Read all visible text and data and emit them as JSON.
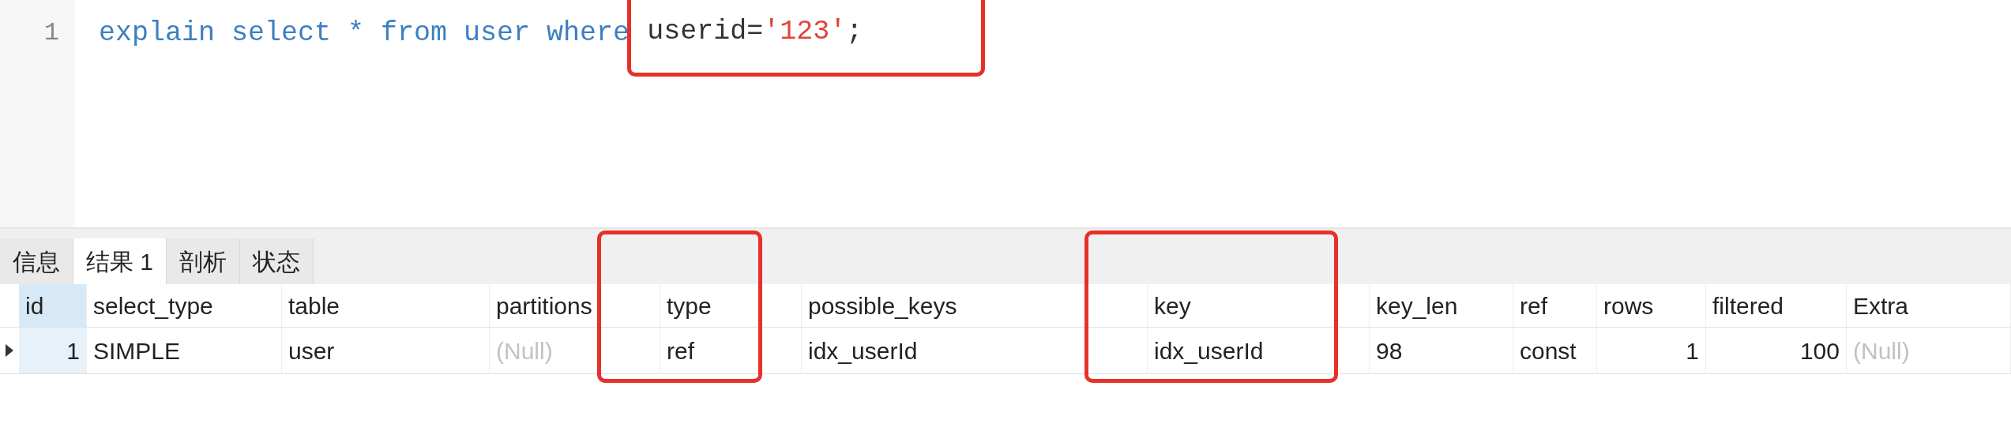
{
  "editor": {
    "lines": [
      {
        "number": "1",
        "segments": [
          {
            "text": "explain select * from user where ",
            "kind": "keyword",
            "highlighted": false
          },
          {
            "text": "userid=",
            "kind": "plain",
            "highlighted": true
          },
          {
            "text": "'123'",
            "kind": "string",
            "highlighted": true
          },
          {
            "text": ";",
            "kind": "plain",
            "highlighted": true
          }
        ]
      }
    ]
  },
  "tabs": [
    {
      "label": "信息",
      "selected": false
    },
    {
      "label": "结果 1",
      "selected": true
    },
    {
      "label": "剖析",
      "selected": false
    },
    {
      "label": "状态",
      "selected": false
    }
  ],
  "table": {
    "columns": [
      {
        "label": "id",
        "kind": "number",
        "selected": true,
        "highlighted": false
      },
      {
        "label": "select_type",
        "kind": "text",
        "selected": false,
        "highlighted": false
      },
      {
        "label": "table",
        "kind": "text",
        "selected": false,
        "highlighted": false
      },
      {
        "label": "partitions",
        "kind": "text",
        "selected": false,
        "highlighted": false
      },
      {
        "label": "type",
        "kind": "text",
        "selected": false,
        "highlighted": true
      },
      {
        "label": "possible_keys",
        "kind": "text",
        "selected": false,
        "highlighted": false
      },
      {
        "label": "key",
        "kind": "text",
        "selected": false,
        "highlighted": true
      },
      {
        "label": "key_len",
        "kind": "text",
        "selected": false,
        "highlighted": false
      },
      {
        "label": "ref",
        "kind": "text",
        "selected": false,
        "highlighted": false
      },
      {
        "label": "rows",
        "kind": "number",
        "selected": false,
        "highlighted": false
      },
      {
        "label": "filtered",
        "kind": "number",
        "selected": false,
        "highlighted": false
      },
      {
        "label": "Extra",
        "kind": "text",
        "selected": false,
        "highlighted": false
      }
    ],
    "rows": [
      {
        "selected": true,
        "cells": [
          {
            "text": "1",
            "null": false
          },
          {
            "text": "SIMPLE",
            "null": false
          },
          {
            "text": "user",
            "null": false
          },
          {
            "text": "(Null)",
            "null": true
          },
          {
            "text": "ref",
            "null": false
          },
          {
            "text": "idx_userId",
            "null": false
          },
          {
            "text": "idx_userId",
            "null": false
          },
          {
            "text": "98",
            "null": false
          },
          {
            "text": "const",
            "null": false
          },
          {
            "text": "1",
            "null": false
          },
          {
            "text": "100",
            "null": false
          },
          {
            "text": "(Null)",
            "null": true
          }
        ]
      }
    ]
  }
}
